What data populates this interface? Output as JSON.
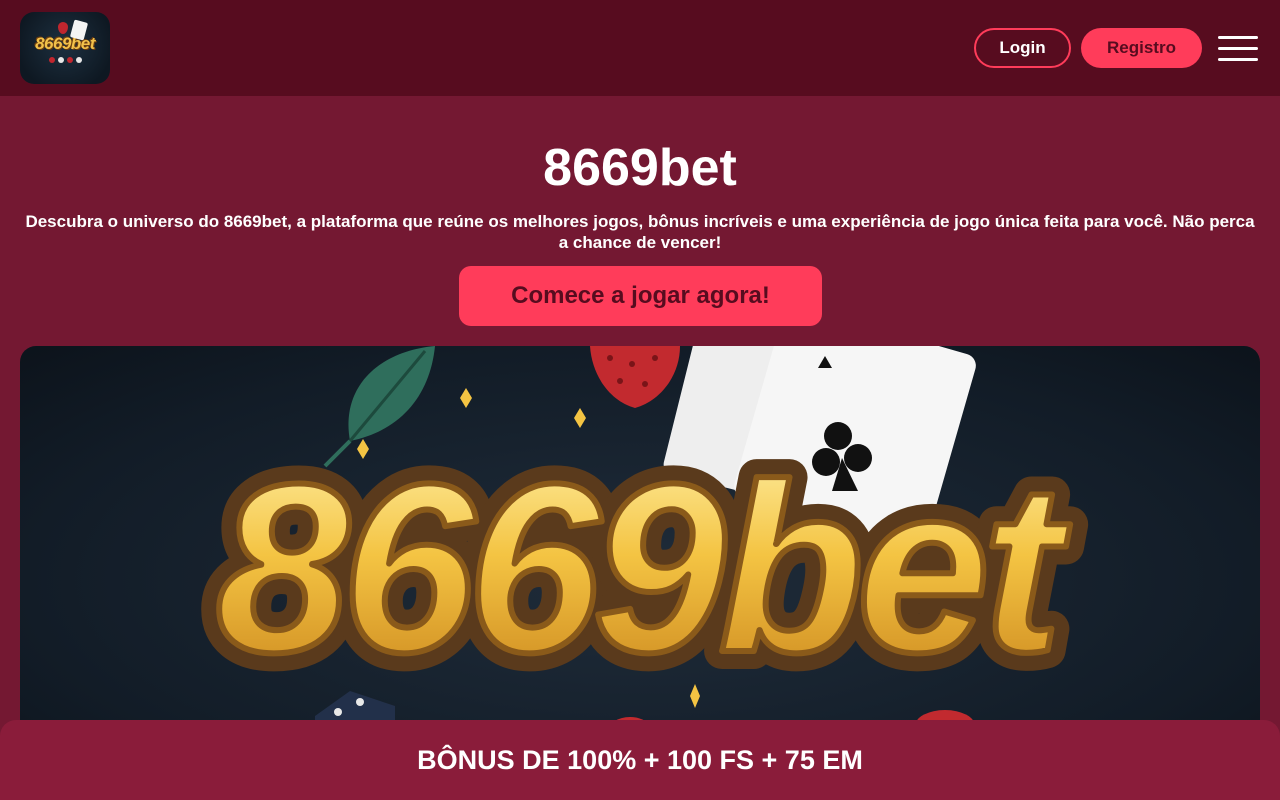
{
  "header": {
    "logo_text": "8669bet",
    "login_label": "Login",
    "register_label": "Registro",
    "menu_icon": "hamburger-menu-icon"
  },
  "hero": {
    "title": "8669bet",
    "description": "Descubra o universo do 8669bet, a plataforma que reúne os melhores jogos, bônus incríveis e uma experiência de jogo única feita para você. Não perca a chance de vencer!",
    "cta_label": "Comece a jogar agora!"
  },
  "banner": {
    "logo_text": "8669bet"
  },
  "bonus_bar": {
    "text": "BÔNUS DE 100% + 100 FS + 75 EM"
  },
  "colors": {
    "header_bg": "#570c1f",
    "page_bg": "#741832",
    "accent": "#ff3c5a",
    "bonus_bg": "#8a1c3a",
    "gold": "#f2c14a"
  }
}
